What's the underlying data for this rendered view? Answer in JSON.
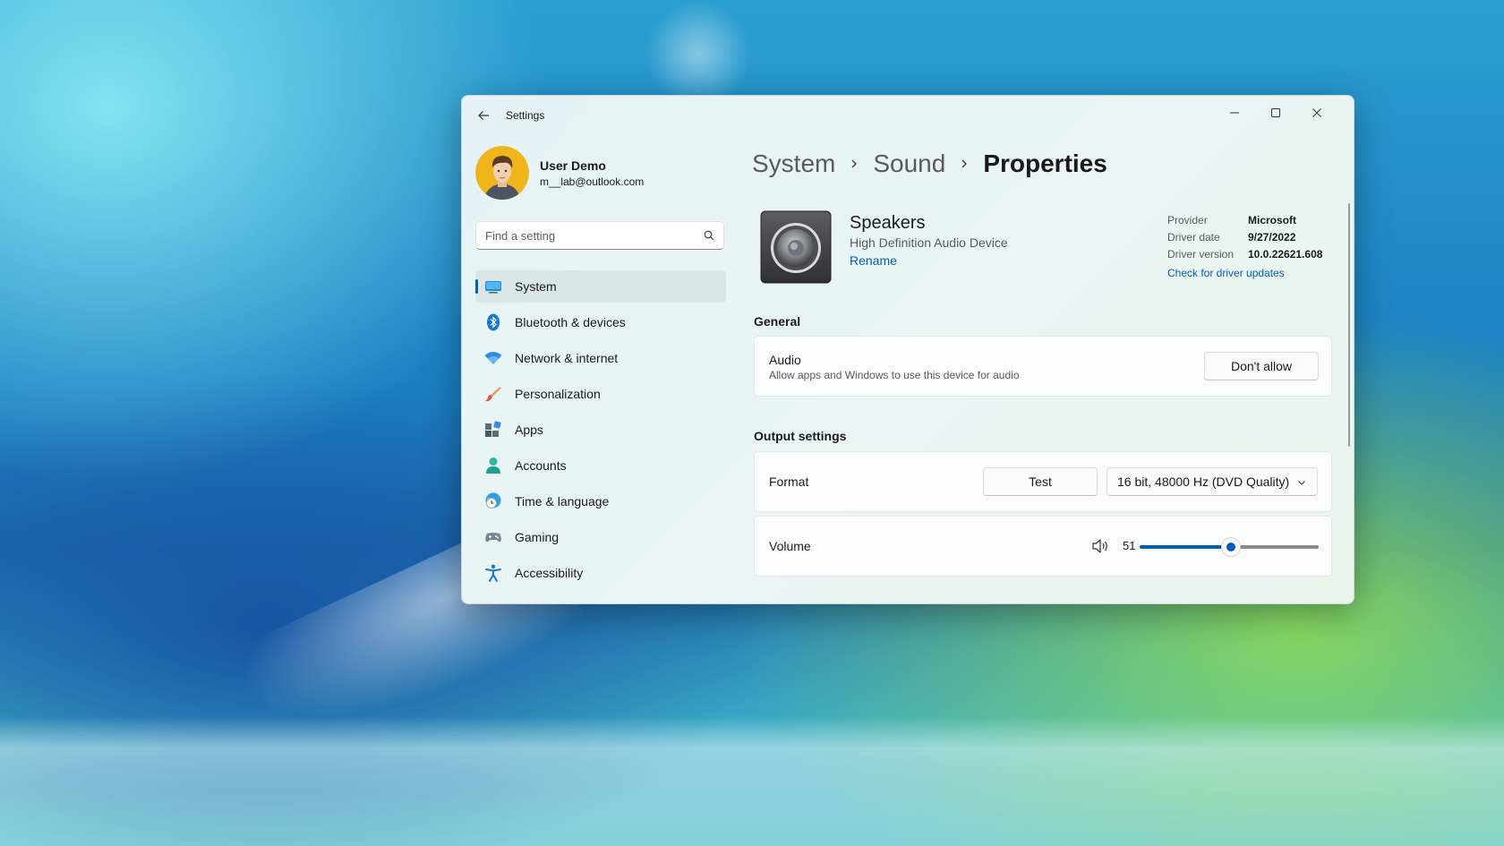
{
  "window": {
    "title": "Settings"
  },
  "profile": {
    "name": "User Demo",
    "email": "m__lab@outlook.com"
  },
  "search": {
    "placeholder": "Find a setting"
  },
  "sidebar": {
    "items": [
      {
        "label": "System",
        "icon": "system-icon",
        "active": true
      },
      {
        "label": "Bluetooth & devices",
        "icon": "bluetooth-icon"
      },
      {
        "label": "Network & internet",
        "icon": "wifi-icon"
      },
      {
        "label": "Personalization",
        "icon": "brush-icon"
      },
      {
        "label": "Apps",
        "icon": "apps-icon"
      },
      {
        "label": "Accounts",
        "icon": "person-icon"
      },
      {
        "label": "Time & language",
        "icon": "globe-clock-icon"
      },
      {
        "label": "Gaming",
        "icon": "gamepad-icon"
      },
      {
        "label": "Accessibility",
        "icon": "accessibility-icon"
      }
    ]
  },
  "breadcrumb": [
    "System",
    "Sound",
    "Properties"
  ],
  "device": {
    "name": "Speakers",
    "subtitle": "High Definition Audio Device",
    "rename_label": "Rename",
    "icon": "speaker-icon"
  },
  "driver": {
    "rows": [
      {
        "key": "Provider",
        "value": "Microsoft"
      },
      {
        "key": "Driver date",
        "value": "9/27/2022"
      },
      {
        "key": "Driver version",
        "value": "10.0.22621.608"
      }
    ],
    "link": "Check for driver updates"
  },
  "general": {
    "title": "General",
    "audio_title": "Audio",
    "audio_desc": "Allow apps and Windows to use this device for audio",
    "button": "Don't allow"
  },
  "output": {
    "title": "Output settings",
    "format_label": "Format",
    "test_button": "Test",
    "format_value": "16 bit, 48000 Hz (DVD Quality)",
    "volume_label": "Volume",
    "volume_value": "51",
    "volume_percent": 51
  },
  "colors": {
    "accent": "#005fb8"
  }
}
